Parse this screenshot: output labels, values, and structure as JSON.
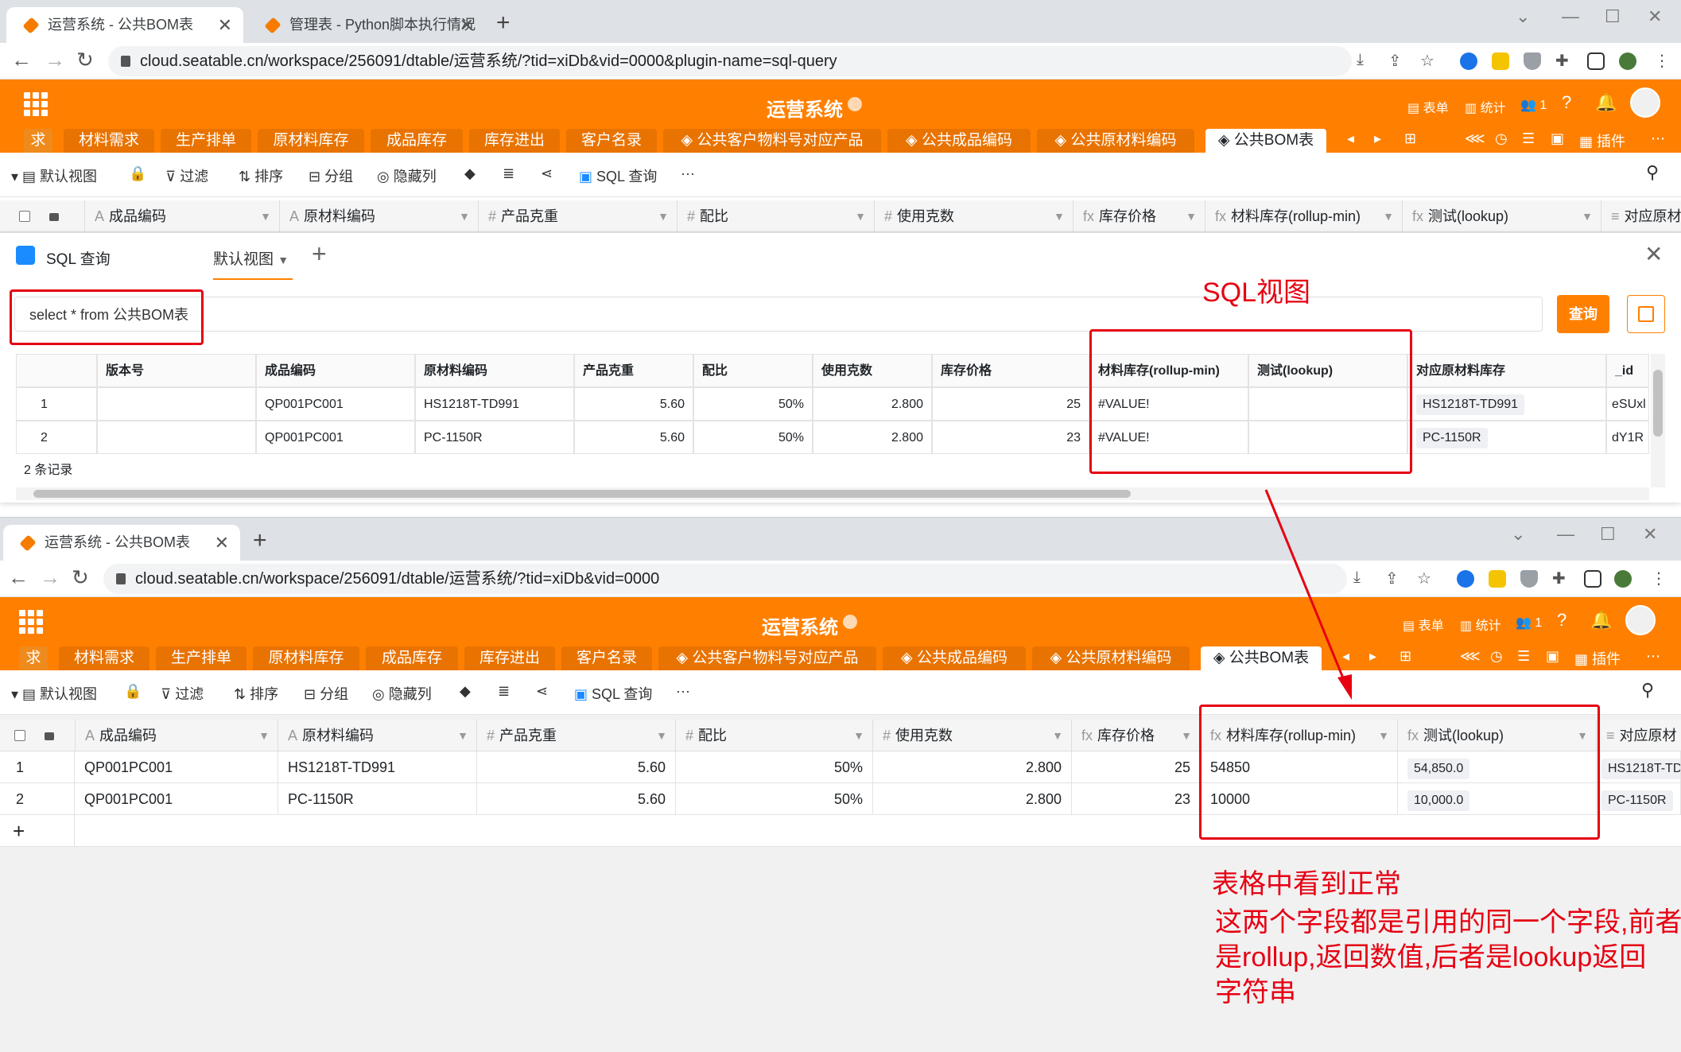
{
  "window_a": {
    "tabs": [
      {
        "title": "运营系统 - 公共BOM表",
        "active": true
      },
      {
        "title": "管理表 - Python脚本执行情况",
        "active": false
      }
    ],
    "url": "cloud.seatable.cn/workspace/256091/dtable/运营系统/?tid=xiDb&vid=0000&plugin-name=sql-query"
  },
  "window_b": {
    "tabs": [
      {
        "title": "运营系统 - 公共BOM表",
        "active": true
      }
    ],
    "url": "cloud.seatable.cn/workspace/256091/dtable/运营系统/?tid=xiDb&vid=0000"
  },
  "app": {
    "title": "运营系统",
    "header_buttons": {
      "form": "表单",
      "stats": "统计",
      "users": "1",
      "plugins": "插件"
    },
    "table_tabs": [
      "求",
      "材料需求",
      "生产排单",
      "原材料库存",
      "成品库存",
      "库存进出",
      "客户名录",
      "公共客户物料号对应产品",
      "公共成品编码",
      "公共原材料编码",
      "公共BOM表"
    ]
  },
  "view_bar": {
    "view": "默认视图",
    "filter": "过滤",
    "sort": "排序",
    "group": "分组",
    "hide": "隐藏列",
    "sql": "SQL 查询",
    "more": "···"
  },
  "columns": [
    {
      "name": "成品编码",
      "icon": "A"
    },
    {
      "name": "原材料编码",
      "icon": "A"
    },
    {
      "name": "产品克重",
      "icon": "#"
    },
    {
      "name": "配比",
      "icon": "#"
    },
    {
      "name": "使用克数",
      "icon": "#"
    },
    {
      "name": "库存价格",
      "icon": "fx"
    },
    {
      "name": "材料库存(rollup-min)",
      "icon": "fx"
    },
    {
      "name": "测试(lookup)",
      "icon": "fx"
    },
    {
      "name": "对应原材",
      "icon": "≡"
    }
  ],
  "sql_panel": {
    "title": "SQL 查询",
    "view_tab": "默认视图",
    "query": "select * from 公共BOM表",
    "query_button": "查询",
    "headers": [
      "版本号",
      "成品编码",
      "原材料编码",
      "产品克重",
      "配比",
      "使用克数",
      "库存价格",
      "材料库存(rollup-min)",
      "测试(lookup)",
      "对应原材料库存",
      "_id"
    ],
    "rows": [
      {
        "no": "1",
        "version": "",
        "product": "QP001PC001",
        "material": "HS1218T-TD991",
        "weight": "5.60",
        "ratio": "50%",
        "grams": "2.800",
        "price": "25",
        "rollup": "#VALUE!",
        "lookup": "",
        "link": "HS1218T-TD991",
        "id": "eSUxl"
      },
      {
        "no": "2",
        "version": "",
        "product": "QP001PC001",
        "material": "PC-1150R",
        "weight": "5.60",
        "ratio": "50%",
        "grams": "2.800",
        "price": "23",
        "rollup": "#VALUE!",
        "lookup": "",
        "link": "PC-1150R",
        "id": "dY1R"
      }
    ],
    "record_count": "2 条记录"
  },
  "grid_rows": [
    {
      "no": "1",
      "product": "QP001PC001",
      "material": "HS1218T-TD991",
      "weight": "5.60",
      "ratio": "50%",
      "grams": "2.800",
      "price": "25",
      "rollup": "54850",
      "lookup": "54,850.0",
      "link": "HS1218T-TD"
    },
    {
      "no": "2",
      "product": "QP001PC001",
      "material": "PC-1150R",
      "weight": "5.60",
      "ratio": "50%",
      "grams": "2.800",
      "price": "23",
      "rollup": "10000",
      "lookup": "10,000.0",
      "link": "PC-1150R"
    }
  ],
  "annotations": {
    "sql_view": "SQL视图",
    "normal_line1": "表格中看到正常",
    "normal_line2": "这两个字段都是引用的同一个字段,前者",
    "normal_line3": "是rollup,返回数值,后者是lookup返回",
    "normal_line4": "字符串"
  },
  "colors": {
    "accent": "#ff8000",
    "annotation": "#e60012"
  }
}
